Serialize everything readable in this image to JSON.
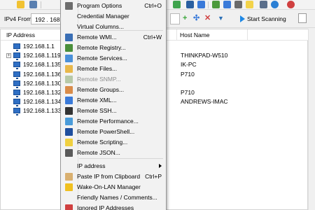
{
  "address_bar": {
    "ipv4_label": "IPv4 From",
    "ip_from_value": "192 . 168",
    "start_label": "Start Scanning"
  },
  "columns": {
    "ip": "IP Address",
    "host": "Host Name"
  },
  "rows": [
    {
      "ip": "192.168.1.1",
      "host": "",
      "expand": false
    },
    {
      "ip": "192.168.1.119",
      "host": "THINKPAD-W510",
      "expand": true
    },
    {
      "ip": "192.168.1.135",
      "host": "IK-PC",
      "expand": false
    },
    {
      "ip": "192.168.1.136",
      "host": "P710",
      "expand": false
    },
    {
      "ip": "192.168.1.130",
      "host": "",
      "expand": false
    },
    {
      "ip": "192.168.1.132",
      "host": "P710",
      "expand": false
    },
    {
      "ip": "192.168.1.134",
      "host": "ANDREWS-IMAC",
      "expand": false
    },
    {
      "ip": "192.168.1.133",
      "host": "",
      "expand": false
    }
  ],
  "menu": {
    "items": [
      {
        "label": "Program Options",
        "shortcut": "Ctrl+O",
        "icon": "gear-icon",
        "color": "#6d6d6d"
      },
      {
        "label": "Credential Manager",
        "shortcut": "",
        "icon": "",
        "color": ""
      },
      {
        "label": "Virtual Columns...",
        "shortcut": "",
        "icon": "",
        "color": ""
      },
      {
        "label": "Remote WMI...",
        "shortcut": "Ctrl+W",
        "icon": "wmi-icon",
        "color": "#3a6fb5"
      },
      {
        "label": "Remote Registry...",
        "shortcut": "",
        "icon": "registry-icon",
        "color": "#4a8f3a"
      },
      {
        "label": "Remote Services...",
        "shortcut": "",
        "icon": "services-icon",
        "color": "#4a90d9"
      },
      {
        "label": "Remote Files...",
        "shortcut": "",
        "icon": "files-icon",
        "color": "#e8b84a"
      },
      {
        "label": "Remote SNMP...",
        "shortcut": "",
        "icon": "snmp-icon",
        "color": "#b7c9a8",
        "disabled": true
      },
      {
        "label": "Remote Groups...",
        "shortcut": "",
        "icon": "groups-icon",
        "color": "#d98c4a"
      },
      {
        "label": "Remote XML...",
        "shortcut": "",
        "icon": "xml-icon",
        "color": "#3a7ad9"
      },
      {
        "label": "Remote SSH...",
        "shortcut": "",
        "icon": "ssh-icon",
        "color": "#333333"
      },
      {
        "label": "Remote Performance...",
        "shortcut": "",
        "icon": "performance-icon",
        "color": "#4a9bd9"
      },
      {
        "label": "Remote PowerShell...",
        "shortcut": "",
        "icon": "powershell-icon",
        "color": "#1f4f9e"
      },
      {
        "label": "Remote Scripting...",
        "shortcut": "",
        "icon": "scripting-icon",
        "color": "#f0d040"
      },
      {
        "label": "Remote JSON...",
        "shortcut": "",
        "icon": "json-icon",
        "color": "#5a5a5a"
      },
      {
        "label": "IP address",
        "shortcut": "",
        "icon": "",
        "color": "",
        "submenu": true
      },
      {
        "label": "Paste IP from Clipboard",
        "shortcut": "Ctrl+P",
        "icon": "paste-icon",
        "color": "#d9b070"
      },
      {
        "label": "Wake-On-LAN Manager",
        "shortcut": "",
        "icon": "wol-icon",
        "color": "#f0c020"
      },
      {
        "label": "Friendly Names / Comments...",
        "shortcut": "",
        "icon": "",
        "color": ""
      },
      {
        "label": "Ignored IP Addresses",
        "shortcut": "",
        "icon": "ignored-icon",
        "color": "#d04040"
      }
    ]
  },
  "toolbar_icons": [
    {
      "name": "add-icon",
      "color": "#f1c232"
    },
    {
      "name": "save-icon",
      "color": "#5a7fb0"
    },
    {
      "name": "network-icon",
      "color": "#3fa34d"
    },
    {
      "name": "table-icon",
      "color": "#2a5fa0"
    },
    {
      "name": "columns-icon",
      "color": "#3a7ad9"
    },
    {
      "name": "gear-green-icon",
      "color": "#4c9a3b"
    },
    {
      "name": "gear-blue-icon",
      "color": "#3a7ad9"
    },
    {
      "name": "grid-icon",
      "color": "#6a6a6a"
    },
    {
      "name": "note-icon",
      "color": "#f3d34a"
    },
    {
      "name": "settings-icon",
      "color": "#5a6e8a"
    },
    {
      "name": "help-icon",
      "color": "#2a7fd4"
    },
    {
      "name": "power-icon",
      "color": "#d04040"
    }
  ]
}
